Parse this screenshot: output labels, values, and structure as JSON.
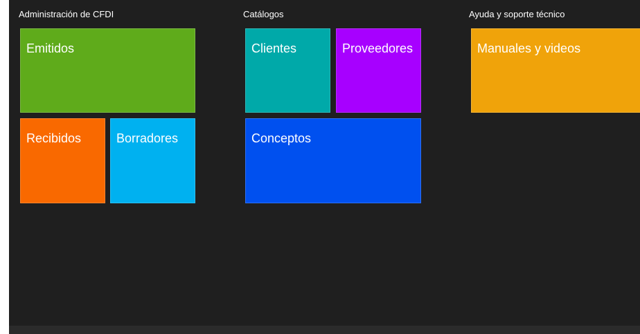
{
  "groups": {
    "admin": {
      "title": "Administración de CFDI",
      "tiles": {
        "emitidos": {
          "label": "Emitidos",
          "color": "#5fab1b"
        },
        "recibidos": {
          "label": "Recibidos",
          "color": "#f96900"
        },
        "borradores": {
          "label": "Borradores",
          "color": "#00b1f0"
        }
      }
    },
    "catalogos": {
      "title": "Catálogos",
      "tiles": {
        "clientes": {
          "label": "Clientes",
          "color": "#00a9a9"
        },
        "proveedores": {
          "label": "Proveedores",
          "color": "#a700ff"
        },
        "conceptos": {
          "label": "Conceptos",
          "color": "#0050ef"
        }
      }
    },
    "ayuda": {
      "title": "Ayuda y soporte técnico",
      "tiles": {
        "manuales": {
          "label": "Manuales y videos",
          "color": "#f0a30a"
        }
      }
    }
  },
  "theme": {
    "background": "#1f1f1f",
    "text": "#ffffff"
  }
}
